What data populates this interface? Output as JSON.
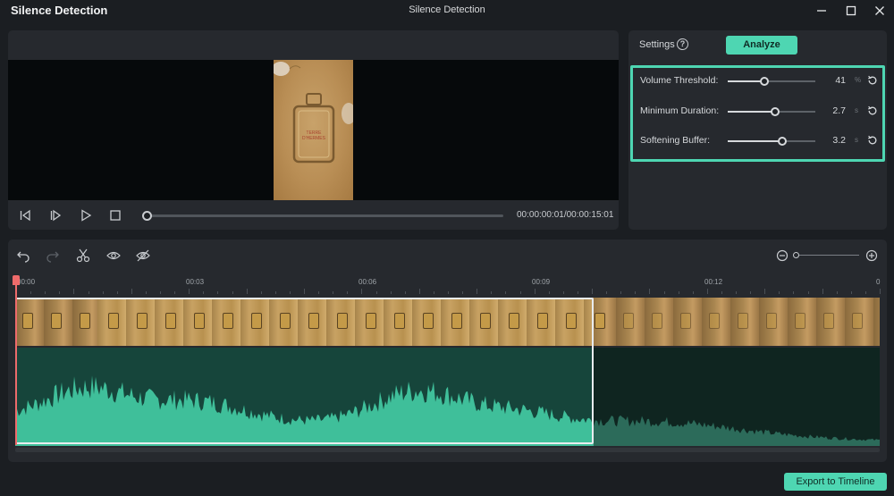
{
  "app_title": "Silence Detection",
  "window_title": "Silence Detection",
  "window_controls": [
    "minimize-icon",
    "maximize-icon",
    "close-icon"
  ],
  "preview": {
    "thumbnail_text": "TERRE D'HERMES",
    "time_display": "00:00:00:01/00:00:15:01",
    "scrub_progress": 0.0,
    "controls": [
      "step-back-icon",
      "step-forward-icon",
      "play-icon",
      "stop-icon"
    ]
  },
  "settings": {
    "title": "Settings",
    "help_glyph": "?",
    "analyze_label": "Analyze",
    "rows": [
      {
        "label": "Volume Threshold:",
        "value": "41",
        "unit": "%",
        "slider": 0.42
      },
      {
        "label": "Minimum Duration:",
        "value": "2.7",
        "unit": "s",
        "slider": 0.54
      },
      {
        "label": "Softening Buffer:",
        "value": "3.2",
        "unit": "s",
        "slider": 0.62
      }
    ]
  },
  "timeline": {
    "tools": [
      "undo-icon",
      "redo-icon",
      "cut-icon",
      "eye-icon",
      "eye-off-icon"
    ],
    "zoom_level": 0.0,
    "ruler_labels": [
      "00:00",
      "00:03",
      "00:06",
      "00:09",
      "00:12",
      "0"
    ],
    "selection_end_fraction": 0.669
  },
  "export_label": "Export to Timeline",
  "colors": {
    "accent": "#4ed6b2",
    "playhead": "#ee6b6b",
    "waveform_active": "#3fbf9a",
    "waveform_inactive": "#2c6b5a"
  }
}
